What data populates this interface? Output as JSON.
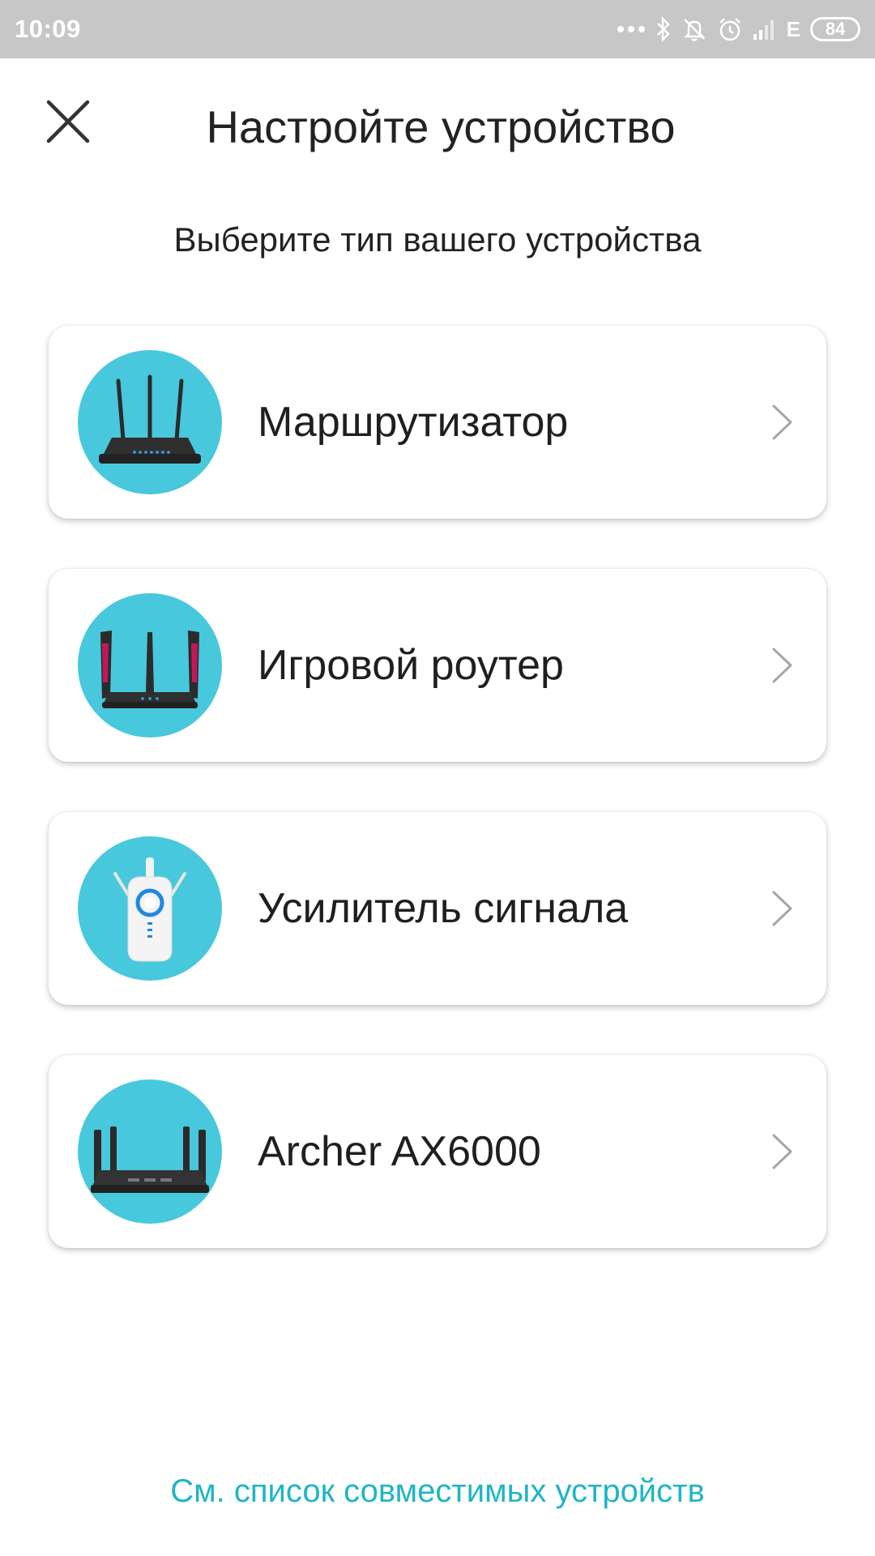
{
  "status_bar": {
    "time": "10:09",
    "battery_level": "84",
    "network_type": "E",
    "icons": [
      "more-dots-icon",
      "bluetooth-icon",
      "notifications-off-icon",
      "alarm-icon",
      "signal-icon",
      "network-e-icon",
      "battery-icon"
    ]
  },
  "header": {
    "title": "Настройте устройство",
    "close_icon": "close-icon"
  },
  "subtitle": "Выберите тип вашего устройства",
  "device_types": [
    {
      "label": "Маршрутизатор",
      "icon": "router-icon"
    },
    {
      "label": "Игровой роутер",
      "icon": "gaming-router-icon"
    },
    {
      "label": "Усилитель сигнала",
      "icon": "range-extender-icon"
    },
    {
      "label": "Archer AX6000",
      "icon": "archer-ax6000-icon"
    }
  ],
  "footer_link": "См. список совместимых устройств",
  "colors": {
    "accent": "#1fb5c4",
    "icon_circle": "#48c8dc",
    "status_bar": "#c7c7c7",
    "text": "#222222"
  }
}
